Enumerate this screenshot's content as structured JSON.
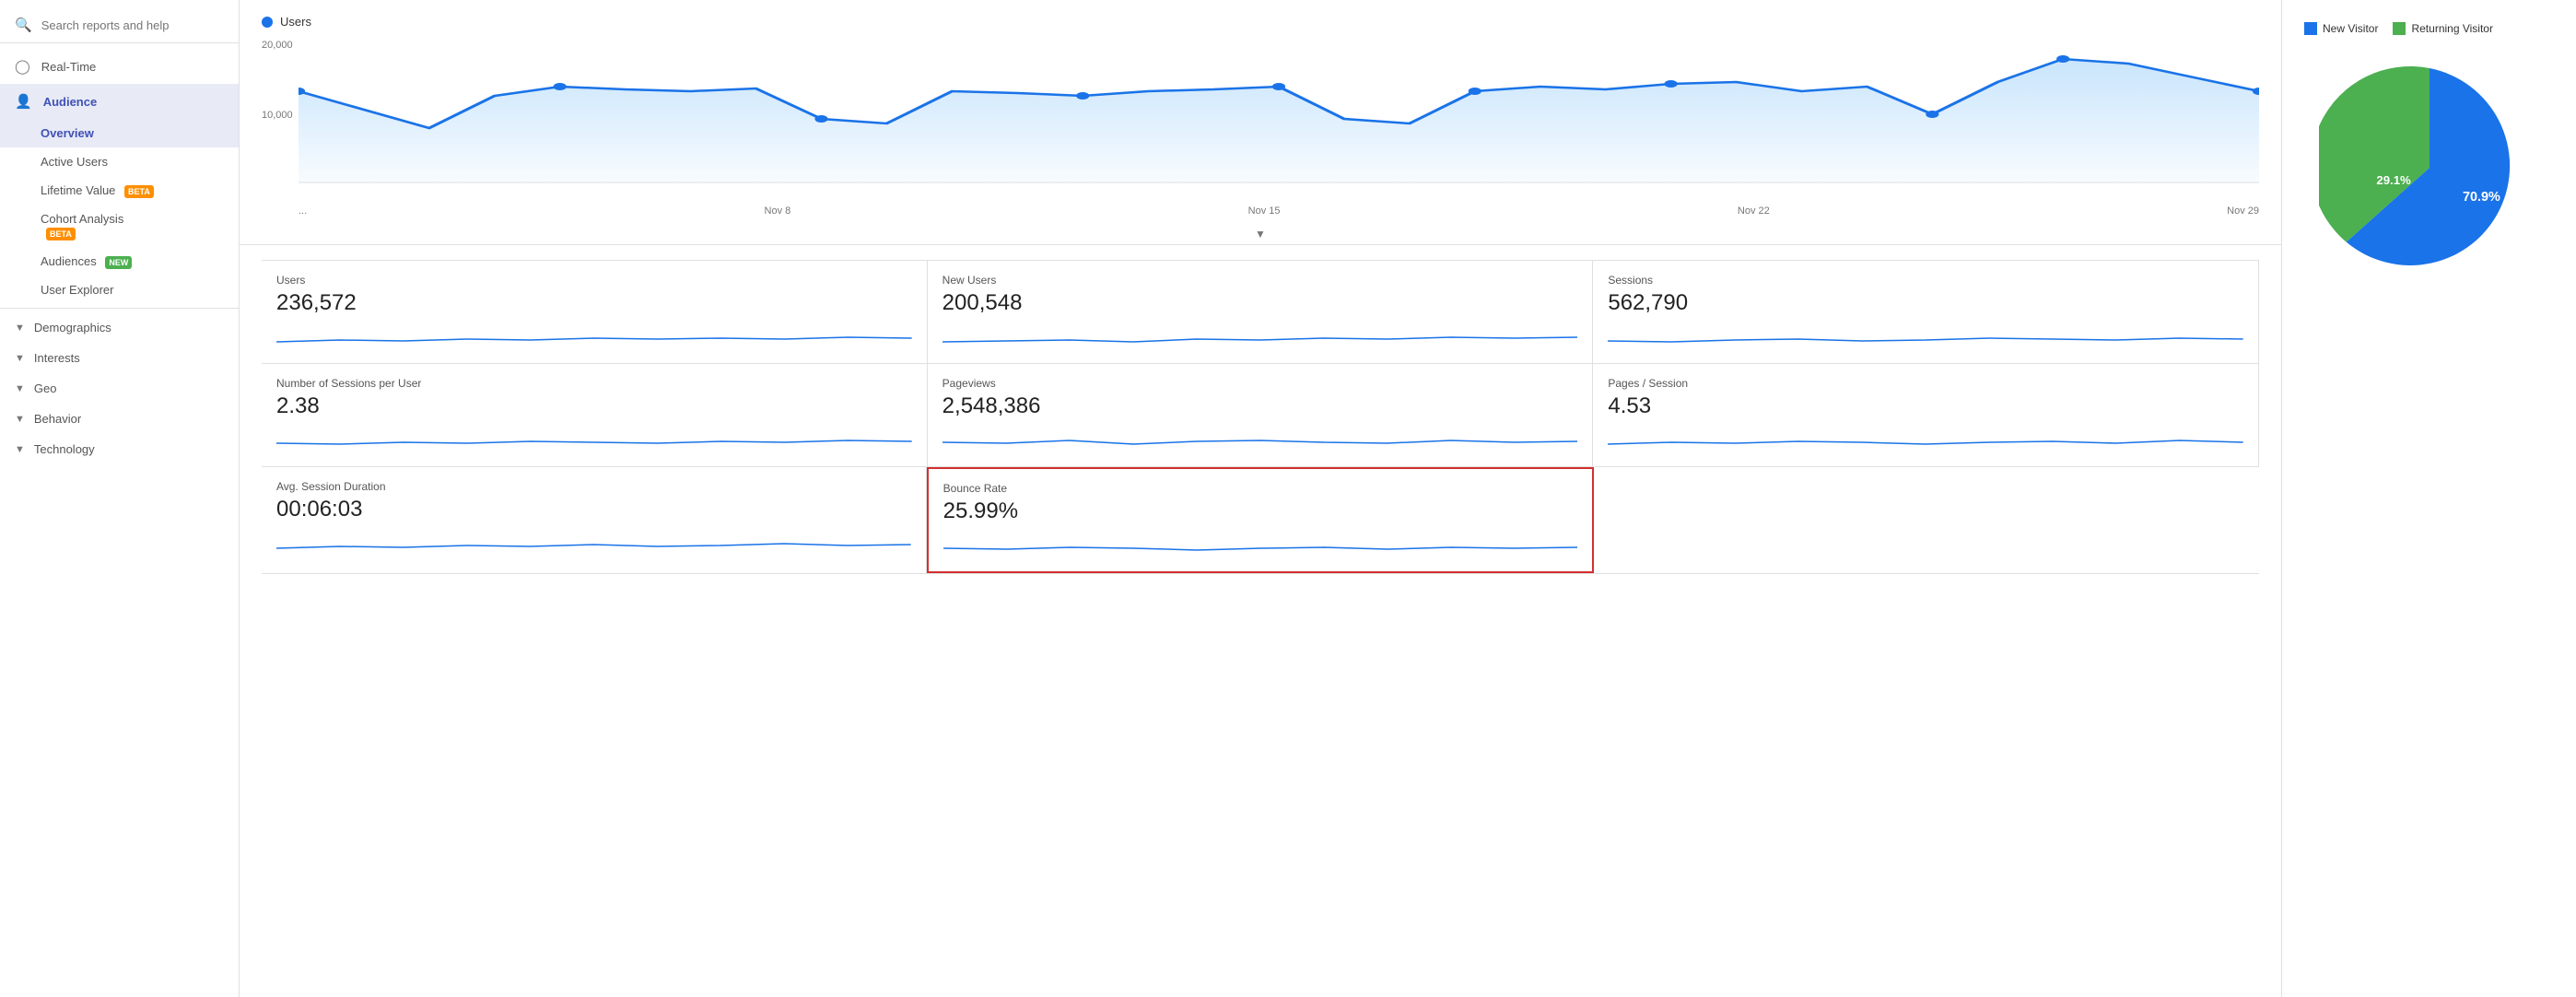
{
  "sidebar": {
    "search_placeholder": "Search reports and help",
    "items": [
      {
        "id": "real-time",
        "label": "Real-Time",
        "icon": "clock"
      },
      {
        "id": "audience",
        "label": "Audience",
        "icon": "person",
        "active": true
      }
    ],
    "sub_items": [
      {
        "id": "overview",
        "label": "Overview",
        "active": true
      },
      {
        "id": "active-users",
        "label": "Active Users",
        "badge": null
      },
      {
        "id": "lifetime-value",
        "label": "Lifetime Value",
        "badge": "BETA"
      },
      {
        "id": "cohort-analysis",
        "label": "Cohort Analysis",
        "badge": "BETA"
      },
      {
        "id": "audiences",
        "label": "Audiences",
        "badge": "NEW"
      },
      {
        "id": "user-explorer",
        "label": "User Explorer"
      }
    ],
    "collapse_items": [
      {
        "id": "demographics",
        "label": "Demographics"
      },
      {
        "id": "interests",
        "label": "Interests"
      },
      {
        "id": "geo",
        "label": "Geo"
      },
      {
        "id": "behavior",
        "label": "Behavior"
      },
      {
        "id": "technology",
        "label": "Technology"
      }
    ]
  },
  "chart": {
    "legend_label": "Users",
    "y_labels": [
      "20,000",
      "10,000"
    ],
    "x_labels": [
      "...",
      "Nov 8",
      "Nov 15",
      "Nov 22",
      "Nov 29"
    ]
  },
  "metrics": [
    {
      "row": 0,
      "cards": [
        {
          "id": "users",
          "label": "Users",
          "value": "236,572"
        },
        {
          "id": "new-users",
          "label": "New Users",
          "value": "200,548"
        },
        {
          "id": "sessions",
          "label": "Sessions",
          "value": "562,790"
        }
      ]
    },
    {
      "row": 1,
      "cards": [
        {
          "id": "sessions-per-user",
          "label": "Number of Sessions per User",
          "value": "2.38"
        },
        {
          "id": "pageviews",
          "label": "Pageviews",
          "value": "2,548,386"
        },
        {
          "id": "pages-session",
          "label": "Pages / Session",
          "value": "4.53"
        }
      ]
    },
    {
      "row": 2,
      "cards": [
        {
          "id": "avg-session-duration",
          "label": "Avg. Session Duration",
          "value": "00:06:03",
          "highlighted": false
        },
        {
          "id": "bounce-rate",
          "label": "Bounce Rate",
          "value": "25.99%",
          "highlighted": true
        }
      ]
    }
  ],
  "pie": {
    "new_visitor_label": "New Visitor",
    "returning_visitor_label": "Returning Visitor",
    "new_visitor_pct": "70.9%",
    "returning_visitor_pct": "29.1%",
    "new_visitor_color": "#1a73e8",
    "returning_visitor_color": "#4caf50"
  }
}
